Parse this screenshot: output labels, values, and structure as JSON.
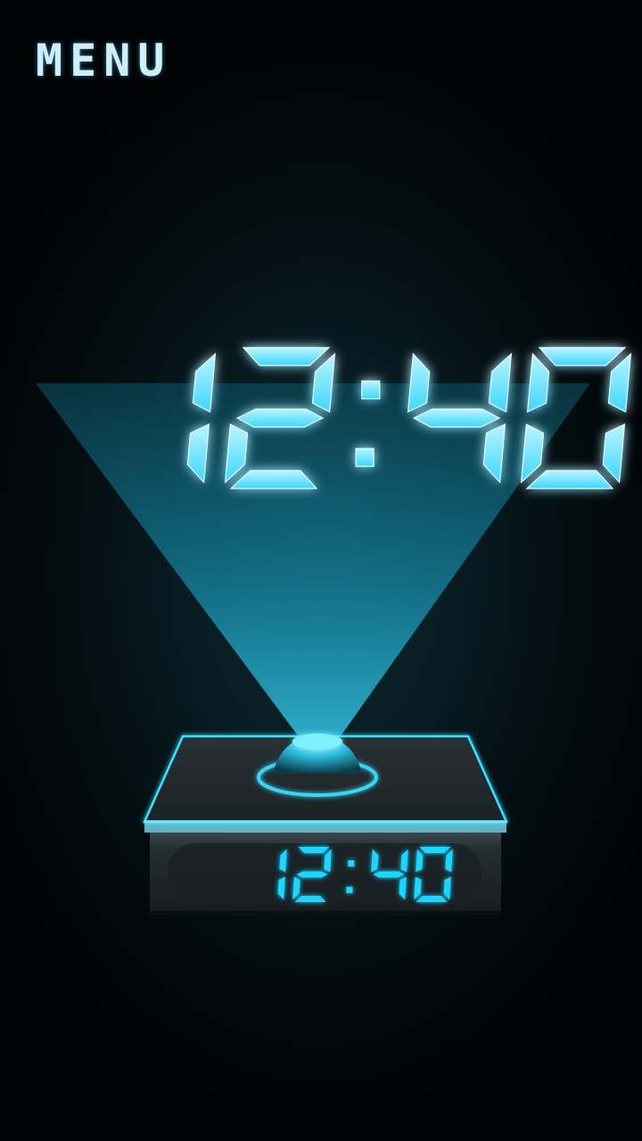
{
  "menu": {
    "label": "MENU"
  },
  "clock": {
    "hologram_time": "12:40",
    "device_time": "12:40",
    "colors": {
      "hologram": "#6fe7ff",
      "device_digits": "#1bd6ff",
      "beam": "#1aa9c9",
      "device_edge": "#39e1ff"
    }
  }
}
